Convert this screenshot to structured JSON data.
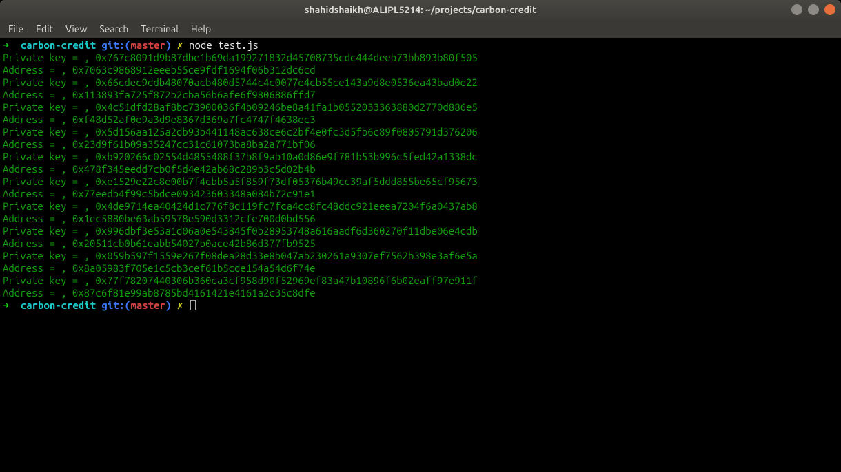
{
  "window": {
    "title": "shahidshaikh@ALIPL5214: ~/projects/carbon-credit"
  },
  "menu": {
    "file": "File",
    "edit": "Edit",
    "view": "View",
    "search": "Search",
    "terminal": "Terminal",
    "help": "Help"
  },
  "prompt": {
    "arrow": "➜",
    "dirname": "carbon-credit",
    "git_label": "git:(",
    "branch": "master",
    "git_close": ")",
    "dirty": "✗",
    "command": "node test.js"
  },
  "output": {
    "pk_label": "Private key = ,",
    "addr_label": "Address = ,",
    "pairs": [
      {
        "pk": "0x767c8091d9b87dbe1b69da199271832d45708735cdc444deeb73bb893b80f505",
        "addr": "0x7063c9868912eeeb55ce9fdf1694f06b312dc6cd"
      },
      {
        "pk": "0x66cdec9ddb48070acb480d5744c4c0077e4cb55ce143a9d8e0536ea43bad0e22",
        "addr": "0x113893fa725f872b2cba56b6afe6f9806886ffd7"
      },
      {
        "pk": "0x4c51dfd28af8bc73900036f4b09246be8a41fa1b0552033363880d2770d886e5",
        "addr": "0xf48d52af0e9a3d9e8367d369a7fc4747f4638ec3"
      },
      {
        "pk": "0x5d156aa125a2db93b441148ac638ce6c2bf4e0fc3d5fb6c89f0805791d376206",
        "addr": "0x23d9f61b09a35247cc31c61073ba8ba2a771bf06"
      },
      {
        "pk": "0xb920266c02554d4855488f37b8f9ab10a0d86e9f781b53b996c5fed42a1338dc",
        "addr": "0x478f345eedd7cb0f5d4e42ab68c289b3c5d02b4b"
      },
      {
        "pk": "0xe1529e22c8e00b7f4cbb5a5f859f73df05376b49cc39af5ddd855be65cf95673",
        "addr": "0x77eedb4f99c5bdce093423603348a084b72c91e1"
      },
      {
        "pk": "0x4de9714ea40424d1c776f8d119fc7fca4cc8fc48ddc921eeea7204f6a0437ab8",
        "addr": "0x1ec5880be63ab59578e590d3312cfe700d0bd556"
      },
      {
        "pk": "0x996dbf3e53a1d06a0e543845f0b28953748a616aadf6d360270f11dbe06e4cdb",
        "addr": "0x20511cb0b61eabb54027b0ace42b86d377fb9525"
      },
      {
        "pk": "0x059b597f1559e267f08dea28d33e8b047ab230261a9307ef7562b398e3af6e5a",
        "addr": "0x8a05983f705e1c5cb3cef61b5cde154a54d6f74e"
      },
      {
        "pk": "0x77f78207440306b360ca3cf958d90f52969ef83a47b10896f6b02eaff97e911f",
        "addr": "0x87c6f81e99ab8785bd4161421e4161a2c35c8dfe"
      }
    ]
  }
}
